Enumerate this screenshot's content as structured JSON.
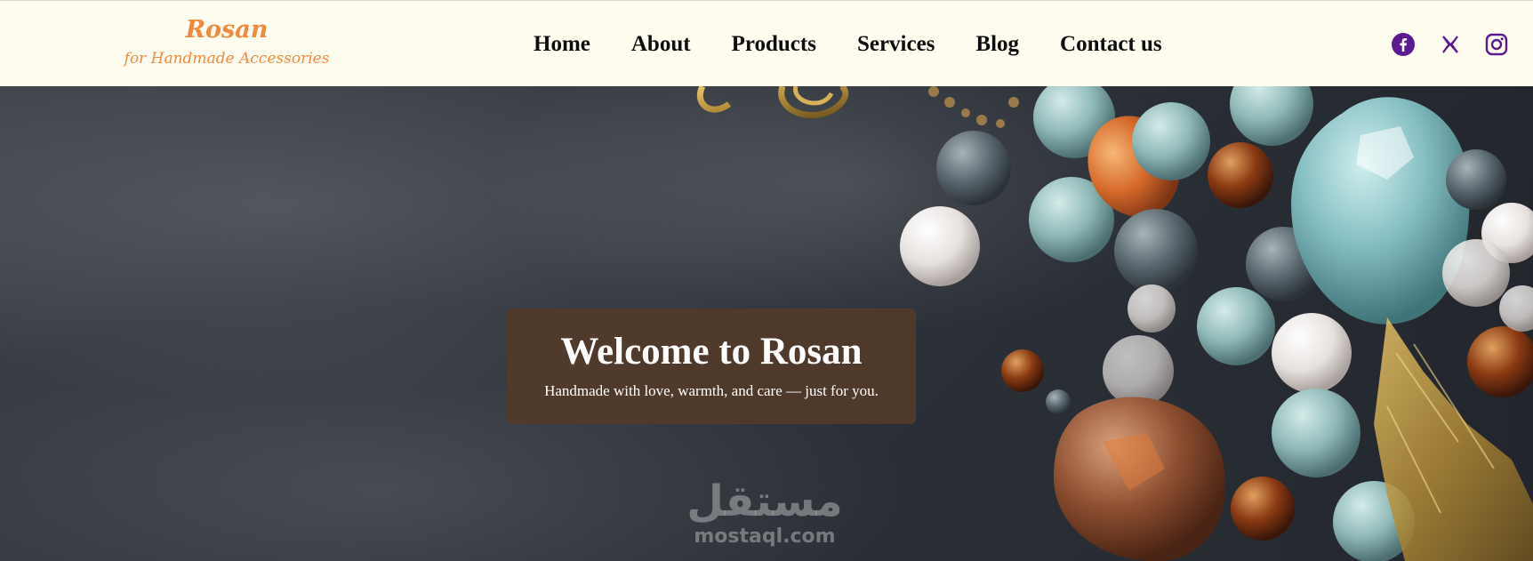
{
  "brand": {
    "name": "Rosan",
    "tagline": "for Handmade Accessories",
    "accent_color": "#f08a3e"
  },
  "nav": {
    "items": [
      {
        "label": "Home"
      },
      {
        "label": "About"
      },
      {
        "label": "Products"
      },
      {
        "label": "Services"
      },
      {
        "label": "Blog"
      },
      {
        "label": "Contact us"
      }
    ]
  },
  "social": {
    "icon_color": "#5b1a8f",
    "icons": [
      "facebook-icon",
      "x-icon",
      "instagram-icon"
    ]
  },
  "hero": {
    "title": "Welcome to Rosan",
    "subtitle": "Handmade with love, warmth, and care — just for you.",
    "image": "gemstone-beads-jewelry-image",
    "box_color": "#523a2a"
  },
  "watermark": {
    "arabic": "مستقل",
    "url": "mostaql.com"
  }
}
